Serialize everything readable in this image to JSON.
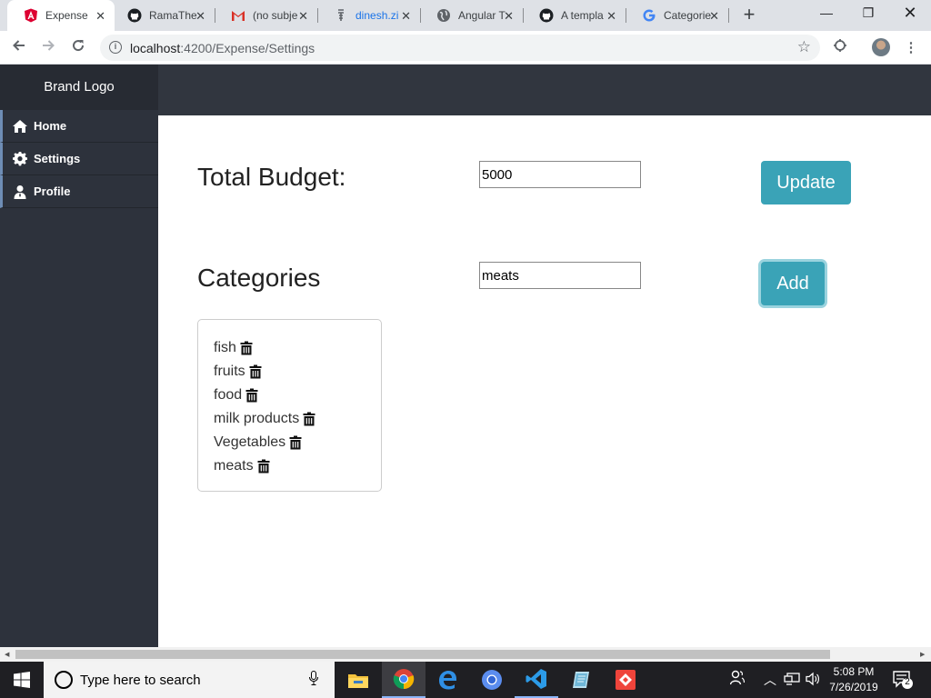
{
  "browser": {
    "tabs": [
      {
        "title": "Expense",
        "favicon": "angular-icon",
        "active": true
      },
      {
        "title": "RamaThe",
        "favicon": "github-icon"
      },
      {
        "title": "(no subje",
        "favicon": "gmail-icon"
      },
      {
        "title": "dinesh.zi",
        "favicon": "archive-icon"
      },
      {
        "title": "Angular T",
        "favicon": "globe-icon"
      },
      {
        "title": "A templa",
        "favicon": "github-icon"
      },
      {
        "title": "Categorie",
        "favicon": "google-icon"
      }
    ],
    "url_host": "localhost",
    "url_path": ":4200/Expense/Settings"
  },
  "app": {
    "brand": "Brand Logo",
    "nav": [
      {
        "label": "Home",
        "icon": "home-icon"
      },
      {
        "label": "Settings",
        "icon": "gear-icon"
      },
      {
        "label": "Profile",
        "icon": "user-icon"
      }
    ],
    "budget": {
      "label": "Total Budget:",
      "value": "5000",
      "button": "Update"
    },
    "categories": {
      "label": "Categories",
      "input_value": "meats",
      "button": "Add",
      "items": [
        "fish",
        "fruits",
        "food",
        "milk products",
        "Vegetables",
        "meats"
      ]
    },
    "colors": {
      "sidebar": "#2d323c",
      "topbar": "#31363f",
      "button": "#3aa3b7"
    }
  },
  "taskbar": {
    "search_placeholder": "Type here to search",
    "time": "5:08 PM",
    "date": "7/26/2019",
    "notification_count": "2"
  }
}
